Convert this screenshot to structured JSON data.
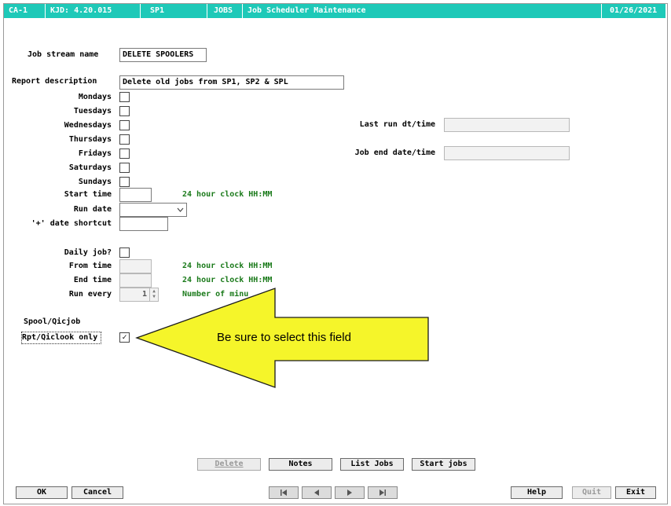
{
  "titlebar": {
    "company": "CA-1",
    "version": "KJD: 4.20.015",
    "program": "SP1",
    "module": "JOBS",
    "screen_title": "Job Scheduler Maintenance",
    "date": "01/26/2021"
  },
  "form": {
    "job_stream_label": "Job stream name",
    "job_stream_value": "DELETE SPOOLERS",
    "report_desc_label": "Report description",
    "report_desc_value": "Delete old jobs from SP1, SP2 & SPL",
    "days": {
      "monday": "Mondays",
      "tuesday": "Tuesdays",
      "wednesday": "Wednesdays",
      "thursday": "Thursdays",
      "friday": "Fridays",
      "saturday": "Saturdays",
      "sunday": "Sundays"
    },
    "last_run_label": "Last run dt/time",
    "job_end_label": "Job end date/time",
    "start_time_label": "Start time",
    "clock_hint": "24 hour clock HH:MM",
    "run_date_label": "Run date",
    "date_shortcut_label": "'+' date shortcut",
    "daily_job_label": "Daily job?",
    "from_time_label": "From time",
    "end_time_label": "End time",
    "run_every_label": "Run every",
    "run_every_value": "1",
    "minutes_hint": "Number of minu",
    "spool_label": "Spool/Qicjob",
    "rpt_only_label": "Rpt/Qiclook only",
    "rpt_only_check": "✓"
  },
  "callout": {
    "text": "Be sure to select this field",
    "color": "#f5f52a"
  },
  "buttons": {
    "delete": "Delete",
    "notes": "Notes",
    "list_jobs": "List Jobs",
    "start_jobs": "Start jobs",
    "ok": "OK",
    "cancel": "Cancel",
    "help": "Help",
    "quit": "Quit",
    "exit": "Exit"
  },
  "colors": {
    "titlebar": "#1ec9b8",
    "hint_text": "#1a7a1a"
  }
}
